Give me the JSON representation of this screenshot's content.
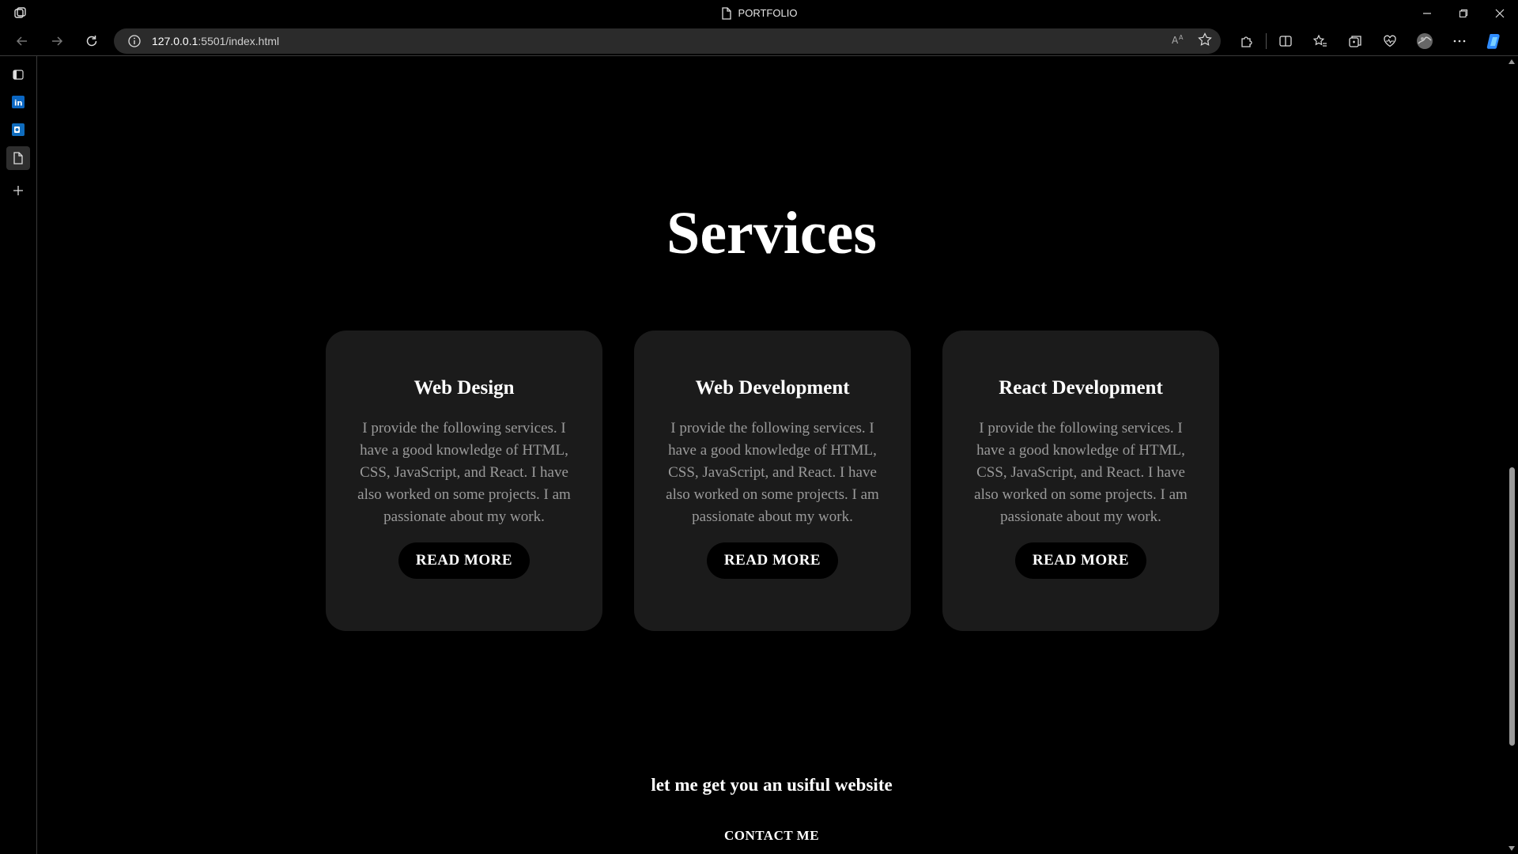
{
  "window": {
    "title": "PORTFOLIO"
  },
  "address_bar": {
    "host": "127.0.0.1",
    "path": ":5501/index.html"
  },
  "main": {
    "heading": "Services",
    "cards": [
      {
        "title": "Web Design",
        "description": "I provide the following services. I have a good knowledge of HTML, CSS, JavaScript, and React. I have also worked on some projects. I am passionate about my work.",
        "button": "READ MORE"
      },
      {
        "title": "Web Development",
        "description": "I provide the following services. I have a good knowledge of HTML, CSS, JavaScript, and React. I have also worked on some projects. I am passionate about my work.",
        "button": "READ MORE"
      },
      {
        "title": "React Development",
        "description": "I provide the following services. I have a good knowledge of HTML, CSS, JavaScript, and React. I have also worked on some projects. I am passionate about my work.",
        "button": "READ MORE"
      }
    ],
    "cta_text": "let me get you an usiful website",
    "contact_label": "CONTACT ME"
  },
  "sidebar": {
    "items": [
      {
        "icon": "tab-actions-icon"
      },
      {
        "icon": "linkedin-icon"
      },
      {
        "icon": "outlook-icon"
      },
      {
        "icon": "page-icon"
      },
      {
        "icon": "plus-icon"
      }
    ]
  },
  "colors": {
    "background": "#000000",
    "card": "#1b1b1b",
    "card_text": "#9a9a9a",
    "heading": "#ffffff",
    "linkedin": "#0a66c2",
    "outlook": "#0f6cbd",
    "copilot": "#2f8cff"
  }
}
